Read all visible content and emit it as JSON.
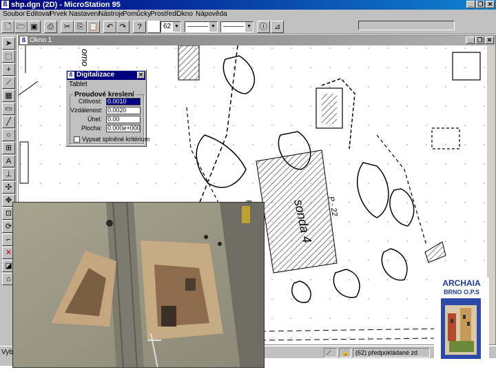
{
  "app": {
    "title": "shp.dgn (2D) - MicroStation 95",
    "window_buttons": [
      "_",
      "❐",
      "✕"
    ]
  },
  "menu": [
    "Soubor",
    "Editovat",
    "Prvek",
    "Nastavení",
    "Nástroje",
    "Pomůcky",
    "Prostředí",
    "Okno",
    "Nápověda"
  ],
  "toolbar": {
    "color_value": "62",
    "style_value": "0",
    "weight_value": "3"
  },
  "view_window": {
    "title": "Okno 1",
    "labels": {
      "sonda": "sonda 4",
      "p22": "P - 22",
      "p_letter": "P",
      "top_text": "omo"
    }
  },
  "dialog": {
    "title": "Digitalizace",
    "menu_label": "Tablet",
    "group_label": "Proudové kreslení",
    "fields": [
      {
        "label": "Citlivost:",
        "value": "0.0010",
        "selected": true
      },
      {
        "label": "Vzdálenost:",
        "value": "0.0020",
        "selected": false
      },
      {
        "label": "Úhel:",
        "value": "0.00",
        "selected": false
      },
      {
        "label": "Plocha:",
        "value": "0.000e+000",
        "selected": false
      }
    ],
    "checkbox_label": "Vypsat splněné kritérium"
  },
  "status": {
    "left": "Vybe",
    "locks": "(62) předpokládané zd"
  },
  "logo": {
    "name": "ARCHAIA",
    "sub": "BRNO O.P.S"
  },
  "colors": {
    "title_active": "#000080",
    "face": "#c0c0c0",
    "logo_blue": "#1a3aa0"
  }
}
